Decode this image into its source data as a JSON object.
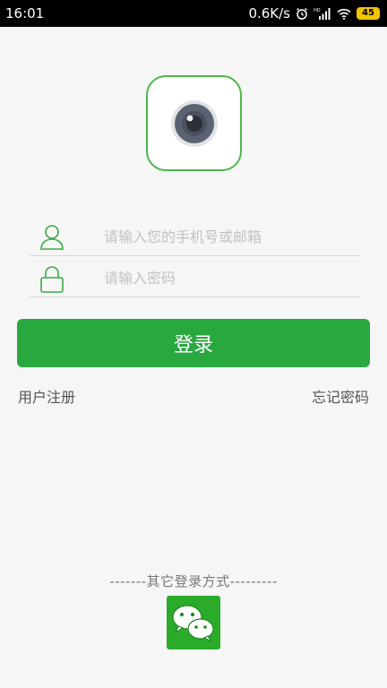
{
  "status_bar": {
    "time": "16:01",
    "network_speed": "0.6K/s",
    "battery": "45",
    "icons": [
      "alarm-icon",
      "hd-signal-icon",
      "wifi-icon",
      "battery-icon"
    ]
  },
  "logo": {
    "icon": "camera-lens-icon",
    "accent_color": "#4cb84c"
  },
  "form": {
    "account_placeholder": "请输入您的手机号或邮箱",
    "account_value": "",
    "account_icon": "user-icon",
    "password_placeholder": "请输入密码",
    "password_value": "",
    "password_icon": "lock-icon"
  },
  "login_button": {
    "label": "登录",
    "color": "#29a83f"
  },
  "links": {
    "register": "用户注册",
    "forgot_password": "忘记密码"
  },
  "other_login": {
    "label": "-------其它登录方式---------",
    "wechat_icon": "wechat-icon",
    "wechat_color": "#2aab2a"
  }
}
